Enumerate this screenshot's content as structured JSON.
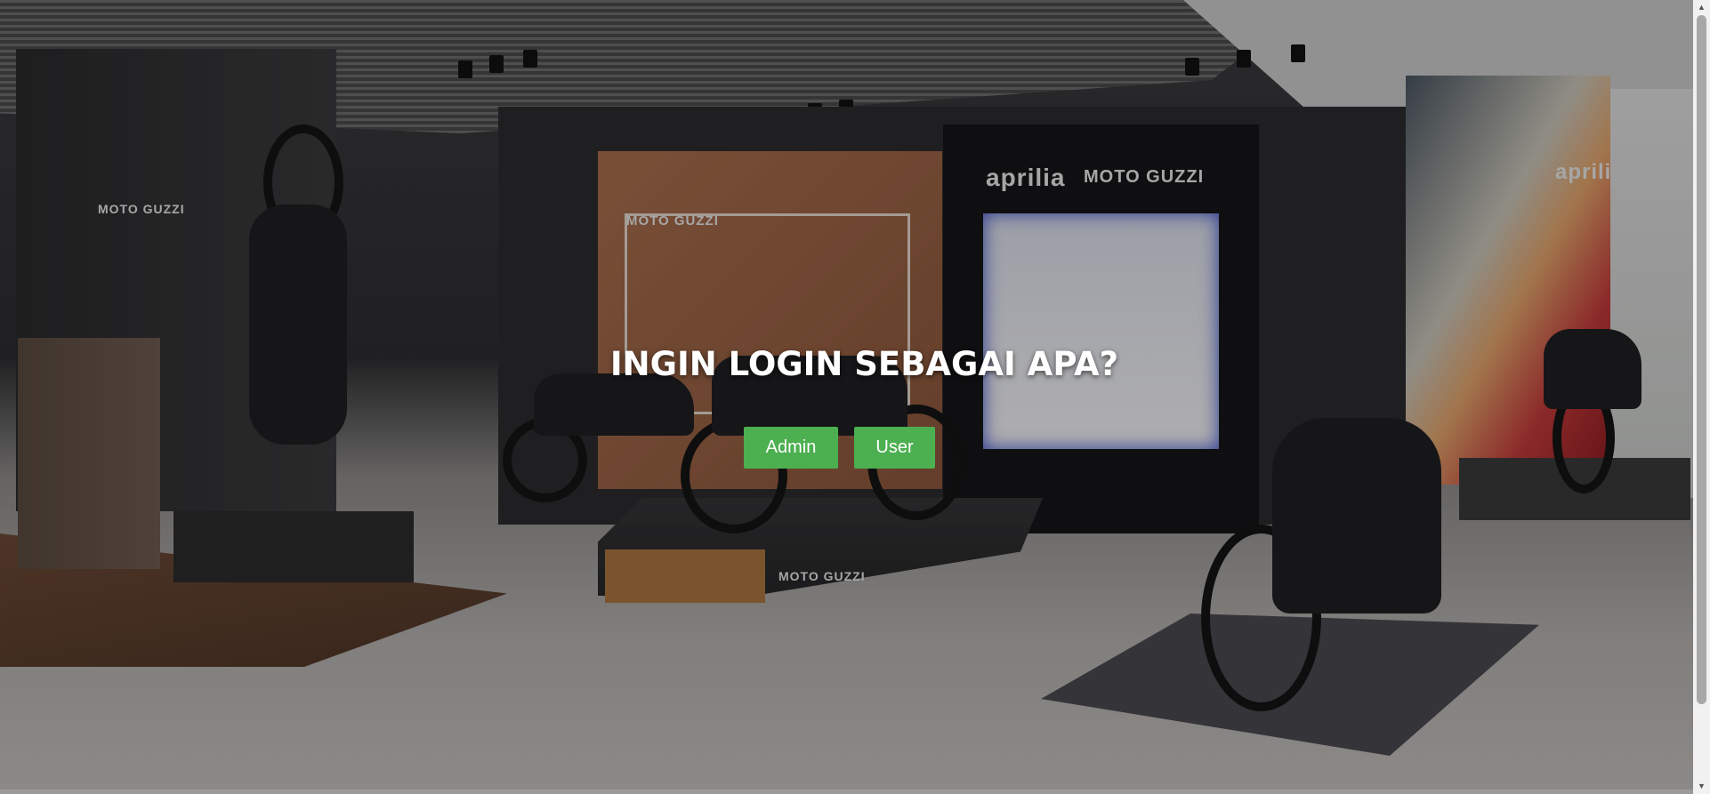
{
  "page": {
    "heading": "INGIN LOGIN SEBAGAI APA?"
  },
  "buttons": {
    "admin_label": "Admin",
    "user_label": "User",
    "color": "#4caf50"
  },
  "background": {
    "brand_marks": [
      "MOTO GUZZI",
      "aprilia",
      "MOTO GUZZI",
      "MOTO GUZZI",
      "aprilia",
      "MOTO GUZZI"
    ]
  },
  "scrollbar": {
    "up_icon": "triangle-up-icon",
    "down_icon": "triangle-down-icon"
  }
}
